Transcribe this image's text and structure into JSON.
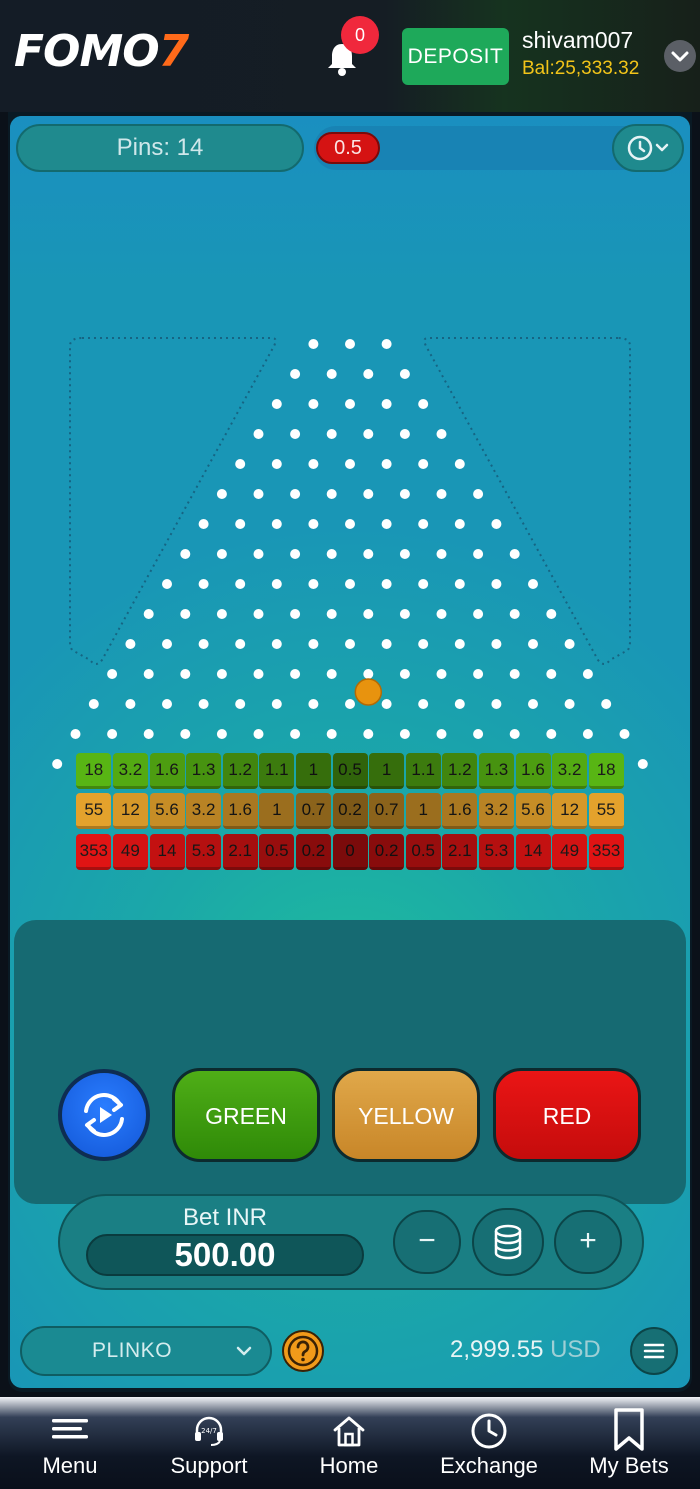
{
  "header": {
    "logo_main": "FOMO",
    "logo_accent": "7",
    "notification_count": "0",
    "deposit_label": "DEPOSIT",
    "username": "shivam007",
    "balance": "Bal:25,333.32"
  },
  "game": {
    "pins_label": "Pins: 14",
    "last_result": "0.5",
    "pins": 14,
    "ball_row": 12,
    "ball_gap": 8,
    "rows": {
      "green": [
        "18",
        "3.2",
        "1.6",
        "1.3",
        "1.2",
        "1.1",
        "1",
        "0.5",
        "1",
        "1.1",
        "1.2",
        "1.3",
        "1.6",
        "3.2",
        "18"
      ],
      "yellow": [
        "55",
        "12",
        "5.6",
        "3.2",
        "1.6",
        "1",
        "0.7",
        "0.2",
        "0.7",
        "1",
        "1.6",
        "3.2",
        "5.6",
        "12",
        "55"
      ],
      "red": [
        "353",
        "49",
        "14",
        "5.3",
        "2.1",
        "0.5",
        "0.2",
        "0",
        "0.2",
        "0.5",
        "2.1",
        "5.3",
        "14",
        "49",
        "353"
      ]
    },
    "colors": {
      "green_row": "#58b514",
      "yellow_row": "#e4a22c",
      "red_row": "#e01414",
      "ball": "#e8930e",
      "pin": "#ffffff"
    }
  },
  "controls": {
    "green_label": "GREEN",
    "yellow_label": "YELLOW",
    "red_label": "RED",
    "bet_label": "Bet INR",
    "bet_value": "500.00",
    "minus_label": "−",
    "plus_label": "+",
    "game_name": "PLINKO",
    "balance_amount": "2,999.55",
    "balance_currency": "USD"
  },
  "nav": {
    "items": [
      {
        "label": "Menu",
        "icon": "hamburger-icon"
      },
      {
        "label": "Support",
        "icon": "headset-24-7-icon"
      },
      {
        "label": "Home",
        "icon": "home-icon"
      },
      {
        "label": "Exchange",
        "icon": "clock-icon"
      },
      {
        "label": "My Bets",
        "icon": "bookmark-icon"
      }
    ]
  }
}
